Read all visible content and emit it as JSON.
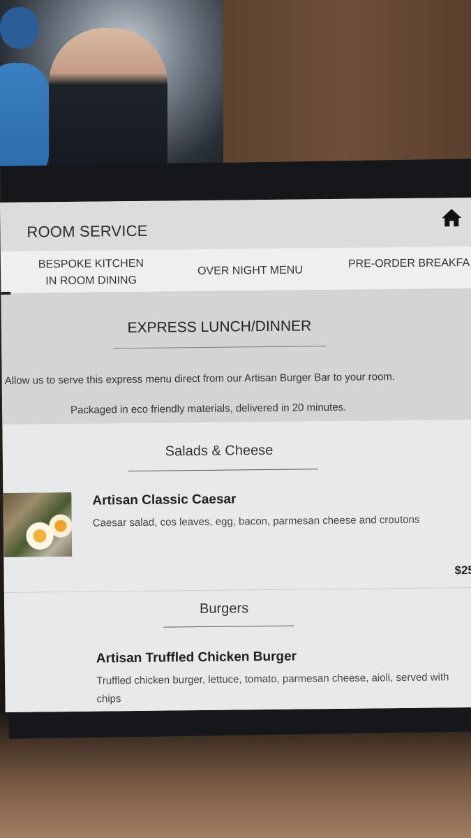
{
  "app": {
    "title": "ROOM SERVICE",
    "home_icon": "home-icon"
  },
  "tabs": [
    {
      "label_line1": "BESPOKE KITCHEN",
      "label_line2": "IN ROOM DINING"
    },
    {
      "label": "OVER NIGHT MENU"
    },
    {
      "label": "PRE-ORDER BREAKFA"
    }
  ],
  "express": {
    "heading": "EXPRESS LUNCH/DINNER",
    "line1": "Allow us to serve this express menu direct from our Artisan Burger Bar to your room.",
    "line2": "Packaged in eco friendly materials, delivered in 20 minutes."
  },
  "sections": [
    {
      "title": "Salads & Cheese",
      "items": [
        {
          "name": "Artisan Classic Caesar",
          "description": "Caesar salad, cos leaves, egg, bacon, parmesan cheese and croutons",
          "price": "$25"
        }
      ]
    },
    {
      "title": "Burgers",
      "items": [
        {
          "name": "Artisan Truffled Chicken Burger",
          "description": "Truffled chicken burger, lettuce, tomato, parmesan cheese, aioli, served with chips"
        }
      ]
    }
  ],
  "colors": {
    "header_bg": "#dcdcdc",
    "tabs_bg": "#efefef",
    "express_bg": "#d4d4d4",
    "content_bg": "#e8e9eb"
  }
}
